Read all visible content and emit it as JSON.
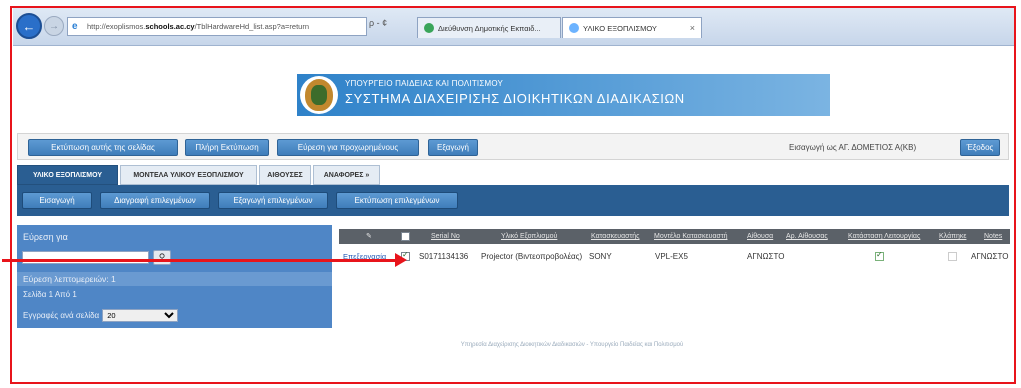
{
  "browser": {
    "url_prefix": "http://exoplismos.",
    "url_domain": "schools.ac.cy",
    "url_suffix": "/TblHardwareHd_list.asp?a=return",
    "addr_tools": "ρ - ¢",
    "tab1_title": "Διεύθυνση Δημοτικής Εκπαιδ...",
    "tab2_title": "ΥΛΙΚΟ ΕΞΟΠΛΙΣΜΟΥ"
  },
  "banner": {
    "ministry": "ΥΠΟΥΡΓΕΙΟ ΠΑΙΔΕΙΑΣ ΚΑΙ ΠΟΛΙΤΙΣΜΟΥ",
    "system": "ΣΥΣΤΗΜΑ ΔΙΑΧΕΙΡΙΣΗΣ ΔΙΟΙΚΗΤΙΚΩΝ ΔΙΑΔΙΚΑΣΙΩΝ"
  },
  "toolbar": {
    "print_page": "Εκτύπωση αυτής της σελίδας",
    "full_print": "Πλήρη Εκτύπωση",
    "advanced_search": "Εύρεση για προχωρημένους",
    "export": "Εξαγωγή",
    "logged_in": "Εισαγωγή ως ΑΓ. ΔΟΜΕΤΙΟΣ Α(ΚΒ)",
    "logout": "Έξοδος"
  },
  "tabs": [
    "ΥΛΙΚΟ ΕΞΟΠΛΙΣΜΟΥ",
    "ΜΟΝΤΕΛΑ ΥΛΙΚΟΥ ΕΞΟΠΛΙΣΜΟΥ",
    "ΑΙΘΟΥΣΕΣ",
    "ΑΝΑΦΟΡΕΣ »"
  ],
  "subbar": {
    "add": "Εισαγωγή",
    "delete_selected": "Διαγραφή επιλεγμένων",
    "export_selected": "Εξαγωγή επιλεγμένων",
    "print_selected": "Εκτύπωση επιλεγμένων"
  },
  "panel": {
    "search_for": "Εύρεση για",
    "search_placeholder": "",
    "details_found": "Εύρεση λεπτομερειών: 1",
    "page_of": "Σελίδα 1 Από 1",
    "per_page_label": "Εγγραφές ανά σελίδα",
    "per_page_value": "20"
  },
  "table": {
    "headers": [
      "Serial No",
      "Υλικό Εξοπλισμού",
      "Κατασκευαστής",
      "Μοντέλο Κατασκευαστή",
      "Αίθουσα",
      "Αρ. Αίθουσας",
      "Κατάσταση Λειτουργίας",
      "Κλάπηκε",
      "Notes"
    ],
    "row": {
      "edit": "Επεξεργασία",
      "serial": "S0171134136",
      "equipment": "Projector (Βιντεοπροβολέας)",
      "manufacturer": "SONY",
      "model": "VPL-EX5",
      "room": "ΑΓΝΩΣΤΟ",
      "notes": "ΑΓΝΩΣΤΟ",
      "selected": true,
      "working": true,
      "stolen": false
    }
  },
  "footer": "Υπηρεσία Διαχείρισης Διοικητικών Διαδικασιών - Υπουργείο Παιδείας και Πολιτισμού",
  "colors": {
    "annotation": "#e8141b",
    "header_blue": "#2a5e92",
    "button_blue": "#4f8bc8"
  }
}
